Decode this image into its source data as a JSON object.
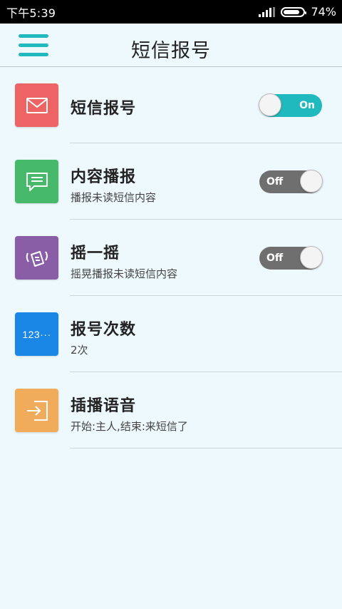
{
  "status_bar": {
    "time": "下午5:39",
    "battery": "74%",
    "battery_level": 0.74
  },
  "app_bar": {
    "title": "短信报号",
    "menu_icon": "hamburger-menu-icon"
  },
  "colors": {
    "accent": "#20b9bd",
    "background": "#eef9fd",
    "icon_mail": "#ee6464",
    "icon_message": "#46b96a",
    "icon_shake": "#8a5ea7",
    "icon_count": "#1a87e6",
    "icon_voice": "#f0ab5b"
  },
  "settings": [
    {
      "title": "短信报号",
      "subtitle": "",
      "icon": "envelope-icon",
      "toggle": {
        "state": "on",
        "label": "On"
      }
    },
    {
      "title": "内容播报",
      "subtitle": "播报未读短信内容",
      "icon": "chat-bubble-icon",
      "toggle": {
        "state": "off",
        "label": "Off"
      }
    },
    {
      "title": "摇一摇",
      "subtitle": "摇晃播报未读短信内容",
      "icon": "shake-phone-icon",
      "toggle": {
        "state": "off",
        "label": "Off"
      }
    },
    {
      "title": "报号次数",
      "subtitle": "2次",
      "icon": "number-count-icon",
      "icon_text": "123···"
    },
    {
      "title": "插播语音",
      "subtitle": "开始:主人,结束:来短信了",
      "icon": "enter-arrow-icon"
    }
  ]
}
